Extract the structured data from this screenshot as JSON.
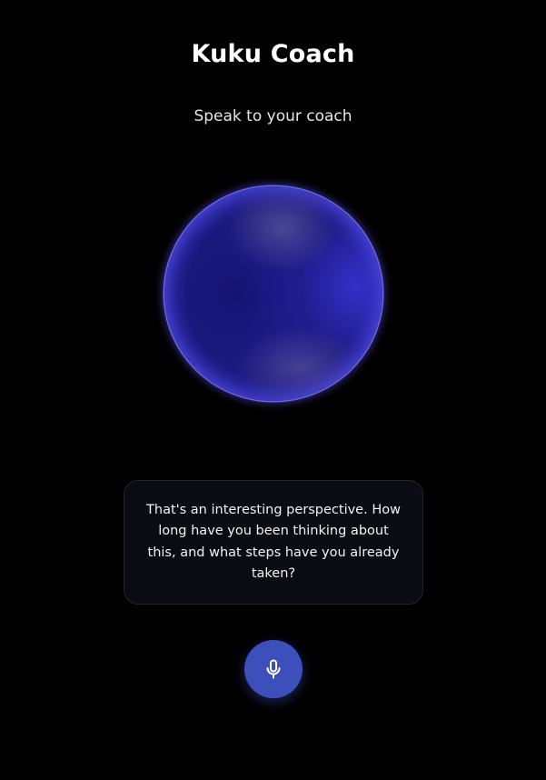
{
  "header": {
    "title": "Kuku Coach",
    "subtitle": "Speak to your coach"
  },
  "coach_message": {
    "text": "That's an interesting perspective. How long have you been thinking about this, and what steps have you already taken?"
  },
  "controls": {
    "mic_icon": "microphone-icon"
  },
  "colors": {
    "background": "#000000",
    "orb_primary": "#231f9a",
    "orb_rim": "#7873ff",
    "card_background": "#0b0b13",
    "mic_button": "#3d4fba"
  }
}
